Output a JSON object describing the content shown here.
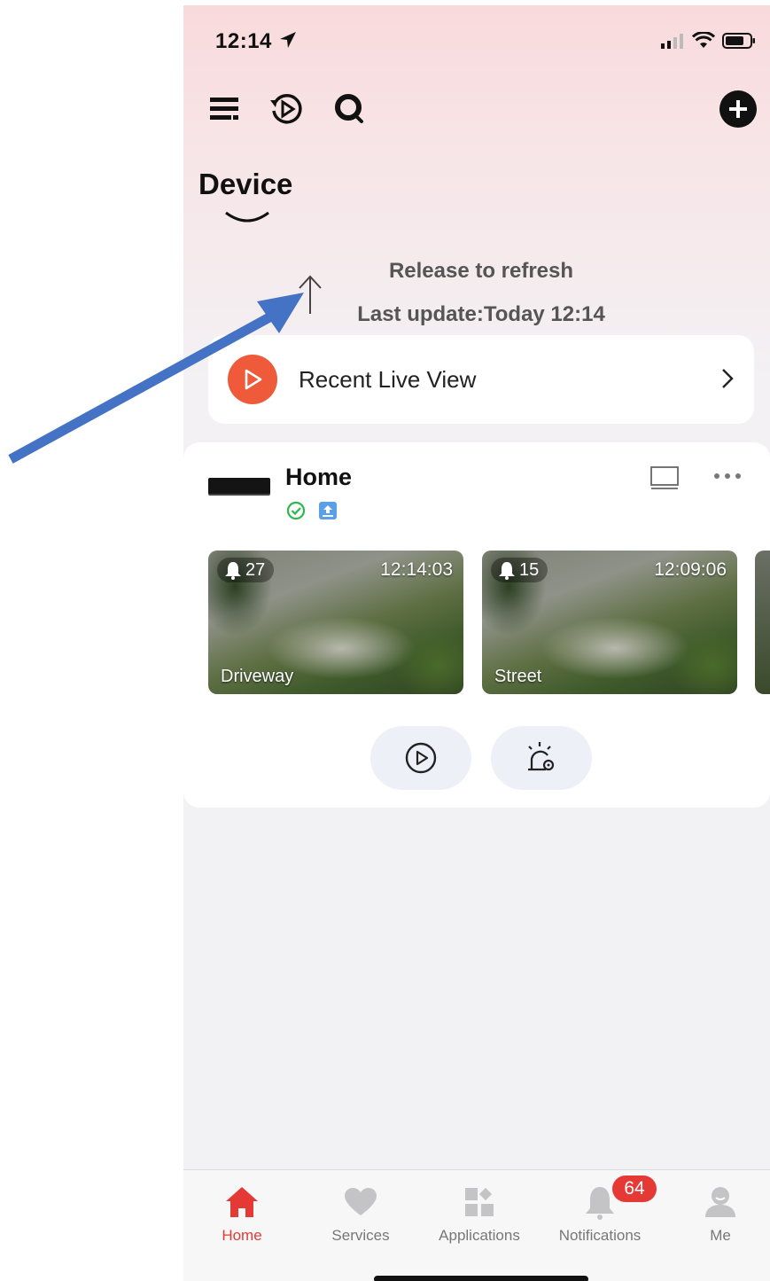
{
  "status_bar": {
    "time": "12:14"
  },
  "page": {
    "title": "Device"
  },
  "refresh": {
    "release_text": "Release to refresh",
    "last_update": "Last update:Today 12:14"
  },
  "recent": {
    "label": "Recent Live View"
  },
  "device": {
    "name": "Home",
    "cameras": [
      {
        "name": "Driveway",
        "count": "27",
        "time": "12:14:03"
      },
      {
        "name": "Street",
        "count": "15",
        "time": "12:09:06"
      }
    ]
  },
  "tabs": [
    {
      "label": "Home",
      "icon": "home-icon",
      "active": true
    },
    {
      "label": "Services",
      "icon": "heart-icon"
    },
    {
      "label": "Applications",
      "icon": "applications-icon"
    },
    {
      "label": "Notifications",
      "icon": "bell-icon"
    },
    {
      "label": "Me",
      "icon": "person-icon"
    }
  ],
  "notification_badge": "64",
  "colors": {
    "accent": "#e53935",
    "recent_play": "#ee5a3a",
    "annotation_arrow": "#4472c4"
  }
}
